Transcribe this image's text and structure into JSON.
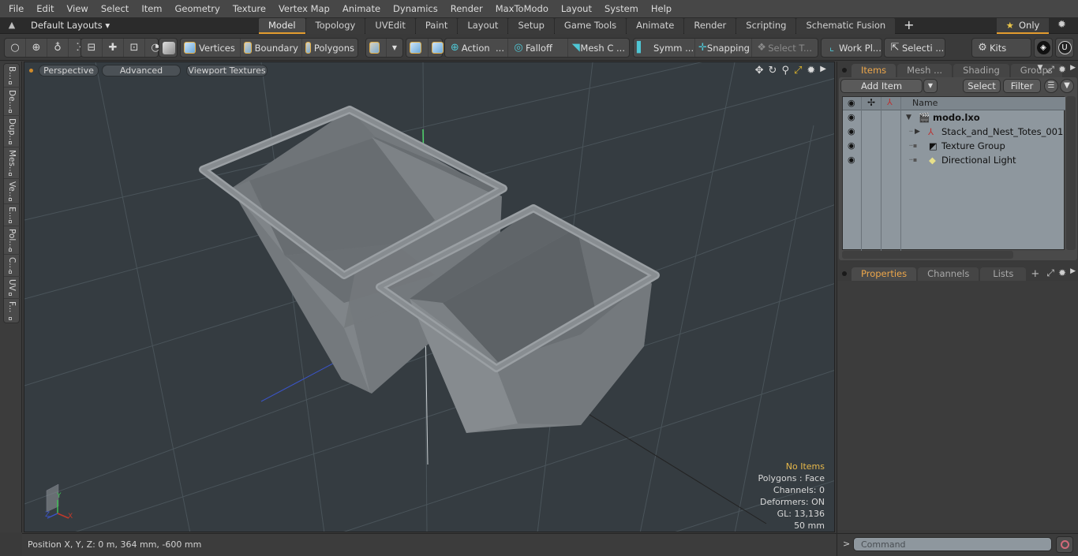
{
  "menu": [
    "File",
    "Edit",
    "View",
    "Select",
    "Item",
    "Geometry",
    "Texture",
    "Vertex Map",
    "Animate",
    "Dynamics",
    "Render",
    "MaxToModo",
    "Layout",
    "System",
    "Help"
  ],
  "layoutbar": {
    "layouts_dropdown": "Default Layouts ▾",
    "tabs": [
      "Model",
      "Topology",
      "UVEdit",
      "Paint",
      "Layout",
      "Setup",
      "Game Tools",
      "Animate",
      "Render",
      "Scripting",
      "Schematic Fusion"
    ],
    "active_tab": "Model",
    "add_tab": "+",
    "only_label": "Only"
  },
  "toolbar": {
    "vertices": "Vertices",
    "boundary": "Boundary",
    "polygons": "Polygons",
    "action": "Action",
    "falloff": "Falloff",
    "mesh_c": "Mesh C ...",
    "symm": "Symm ...",
    "snapping": "Snapping",
    "select_t": "Select T...",
    "work_pl": "Work Pl...",
    "selecti": "Selecti ...",
    "kits": "Kits",
    "ellipsis": "..."
  },
  "left_tabs": [
    "B...",
    "De...",
    "Dup...",
    "Mes...",
    "Ve...",
    "E...",
    "Pol...",
    "C...",
    "UV",
    "F..."
  ],
  "viewport": {
    "view_mode": "Perspective",
    "shading": "Advanced",
    "textures": "Viewport Textures",
    "stats": {
      "selection": "No Items",
      "polygons": "Polygons : Face",
      "channels": "Channels: 0",
      "deformers": "Deformers: ON",
      "gl": "GL: 13,136",
      "grid": "50 mm"
    },
    "axes": {
      "x": "X",
      "y": "Y",
      "z": "Z"
    }
  },
  "statusbar": {
    "position": "Position X, Y, Z:   0 m, 364 mm, -600 mm"
  },
  "items_panel": {
    "tabs": [
      "Items",
      "Mesh ...",
      "Shading",
      "Groups"
    ],
    "active_tab": "Items",
    "add_item": "Add Item",
    "select": "Select",
    "filter": "Filter",
    "column_name": "Name",
    "tree": [
      {
        "label": "modo.lxo",
        "level": 0,
        "expanded": true,
        "bold": true
      },
      {
        "label": "Stack_and_Nest_Totes_001",
        "level": 1,
        "expandable": true
      },
      {
        "label": "Texture Group",
        "level": 1
      },
      {
        "label": "Directional Light",
        "level": 1
      }
    ]
  },
  "properties_panel": {
    "tabs": [
      "Properties",
      "Channels",
      "Lists"
    ],
    "active_tab": "Properties",
    "add_tab": "+"
  },
  "command": {
    "prompt": ">",
    "placeholder": "Command"
  },
  "colors": {
    "accent": "#e39c2e",
    "active_tab_text": "#eca64a",
    "viewport_bg": "#353c41",
    "axis_x": "#c0392b",
    "axis_y": "#3fbf55",
    "axis_z": "#3a54c8"
  }
}
